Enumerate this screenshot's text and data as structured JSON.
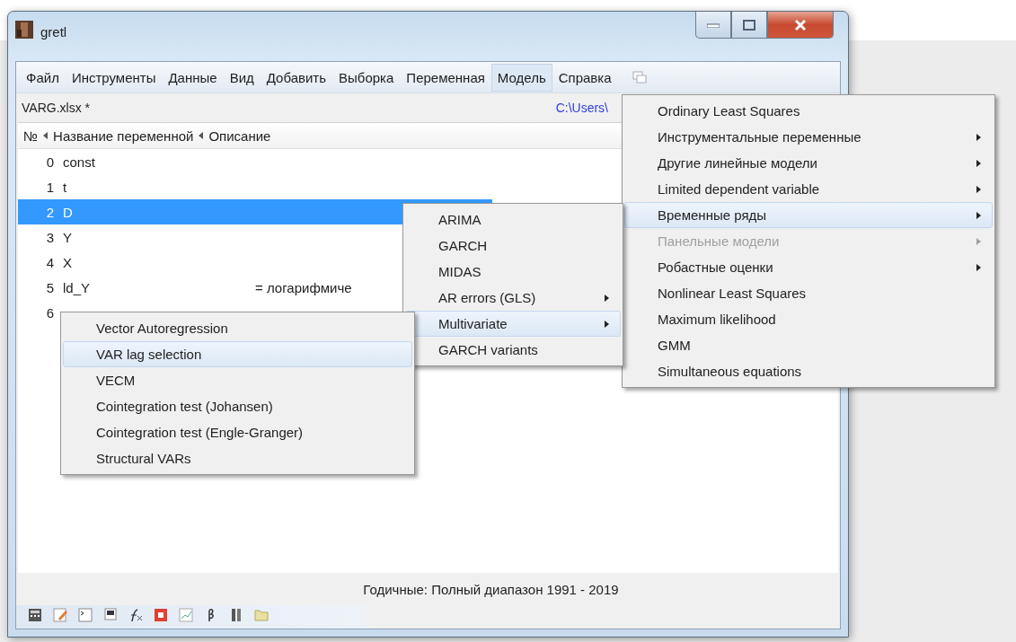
{
  "window": {
    "title": "gretl"
  },
  "menu_bar": [
    {
      "label": "Файл",
      "selected": false
    },
    {
      "label": "Инструменты",
      "selected": false
    },
    {
      "label": "Данные",
      "selected": false
    },
    {
      "label": "Вид",
      "selected": false
    },
    {
      "label": "Добавить",
      "selected": false
    },
    {
      "label": "Выборка",
      "selected": false
    },
    {
      "label": "Переменная",
      "selected": false
    },
    {
      "label": "Модель",
      "selected": true
    },
    {
      "label": "Справка",
      "selected": false
    }
  ],
  "file_bar": {
    "filename": "VARG.xlsx *",
    "path": "C:\\Users\\"
  },
  "table": {
    "columns": [
      "№",
      "Название переменной",
      "Описание"
    ],
    "rows": [
      {
        "no": "0",
        "name": "const",
        "selected": false
      },
      {
        "no": "1",
        "name": "t",
        "selected": false
      },
      {
        "no": "2",
        "name": "D",
        "selected": true
      },
      {
        "no": "3",
        "name": "Y",
        "selected": false
      },
      {
        "no": "4",
        "name": "X",
        "selected": false
      },
      {
        "no": "5",
        "name": "ld_Y",
        "description": "= логарифмиче",
        "selected": false
      },
      {
        "no": "6",
        "selected": false
      }
    ]
  },
  "status_bar": "Годичные: Полный диапазон 1991 - 2019",
  "model_menu": [
    {
      "label": "Ordinary Least Squares",
      "has_submenu": false,
      "disabled": false,
      "selected": false
    },
    {
      "label": "Инструментальные переменные",
      "has_submenu": true,
      "disabled": false,
      "selected": false
    },
    {
      "label": "Другие линейные модели",
      "has_submenu": true,
      "disabled": false,
      "selected": false
    },
    {
      "label": "Limited dependent variable",
      "has_submenu": true,
      "disabled": false,
      "selected": false
    },
    {
      "label": "Временные ряды",
      "has_submenu": true,
      "disabled": false,
      "selected": true
    },
    {
      "label": "Панельные модели",
      "has_submenu": true,
      "disabled": true,
      "selected": false
    },
    {
      "label": "Робастные оценки",
      "has_submenu": true,
      "disabled": false,
      "selected": false
    },
    {
      "label": "Nonlinear Least Squares",
      "has_submenu": false,
      "disabled": false,
      "selected": false
    },
    {
      "label": "Maximum likelihood",
      "has_submenu": false,
      "disabled": false,
      "selected": false
    },
    {
      "label": "GMM",
      "has_submenu": false,
      "disabled": false,
      "selected": false
    },
    {
      "label": "Simultaneous equations",
      "has_submenu": false,
      "disabled": false,
      "selected": false
    }
  ],
  "time_series_menu": [
    {
      "label": "ARIMA",
      "has_submenu": false,
      "disabled": false,
      "selected": false
    },
    {
      "label": "GARCH",
      "has_submenu": false,
      "disabled": false,
      "selected": false
    },
    {
      "label": "MIDAS",
      "has_submenu": false,
      "disabled": false,
      "selected": false
    },
    {
      "label": "AR errors (GLS)",
      "has_submenu": true,
      "disabled": false,
      "selected": false
    },
    {
      "label": "Multivariate",
      "has_submenu": true,
      "disabled": false,
      "selected": true
    },
    {
      "label": "GARCH variants",
      "has_submenu": false,
      "disabled": false,
      "selected": false
    }
  ],
  "multivariate_menu": [
    {
      "label": "Vector Autoregression",
      "has_submenu": false,
      "disabled": false,
      "selected": false
    },
    {
      "label": "VAR lag selection",
      "has_submenu": false,
      "disabled": false,
      "selected": true
    },
    {
      "label": "VECM",
      "has_submenu": false,
      "disabled": false,
      "selected": false
    },
    {
      "label": "Cointegration test (Johansen)",
      "has_submenu": false,
      "disabled": false,
      "selected": false
    },
    {
      "label": "Cointegration test (Engle-Granger)",
      "has_submenu": false,
      "disabled": false,
      "selected": false
    },
    {
      "label": "Structural VARs",
      "has_submenu": false,
      "disabled": false,
      "selected": false
    }
  ]
}
